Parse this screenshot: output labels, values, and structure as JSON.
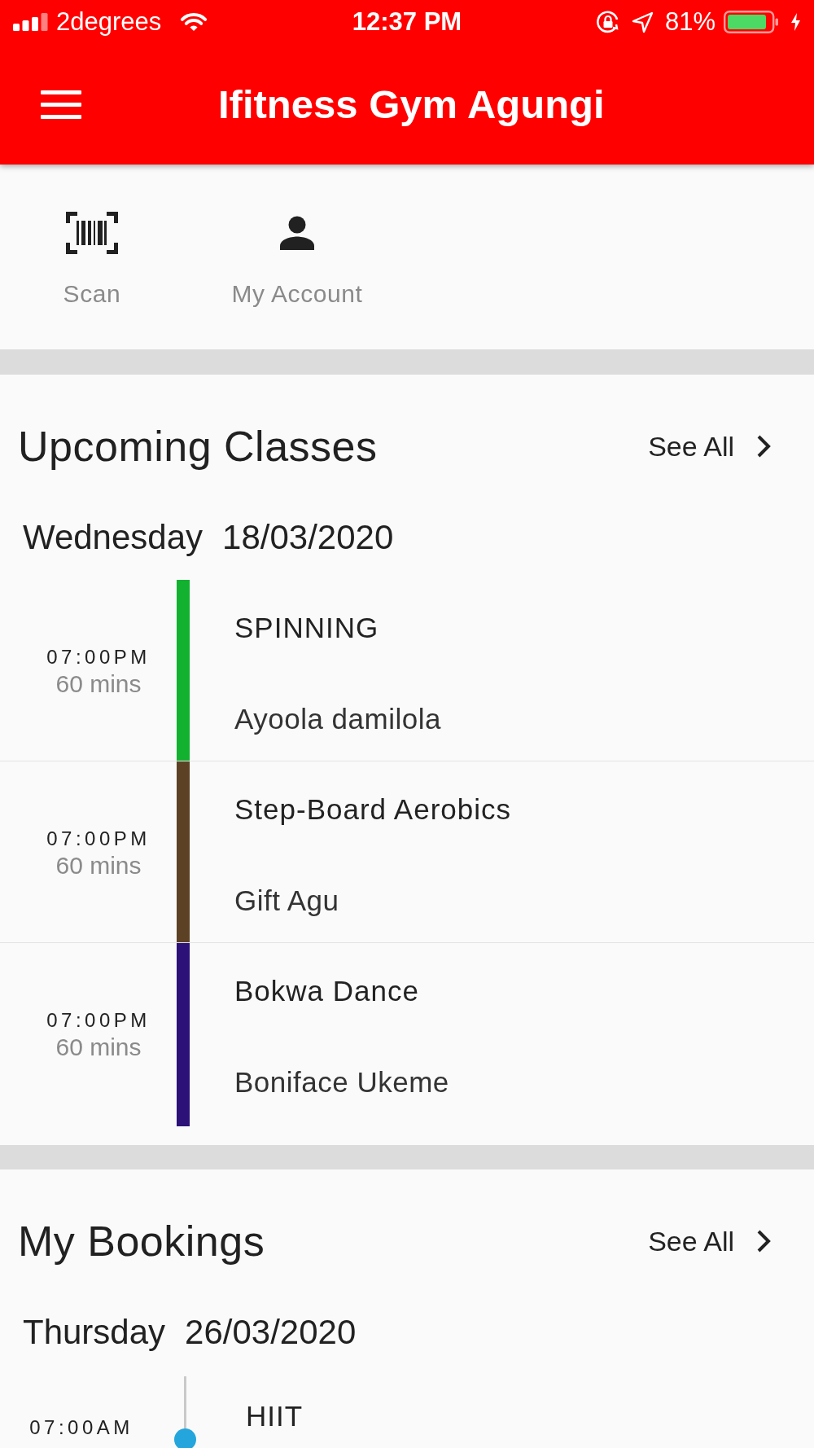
{
  "status_bar": {
    "carrier": "2degrees",
    "time": "12:37 PM",
    "battery": "81%"
  },
  "app_bar": {
    "title": "Ifitness Gym Agungi"
  },
  "quick_actions": [
    {
      "kind": "scan",
      "label": "Scan"
    },
    {
      "kind": "account",
      "label": "My Account"
    }
  ],
  "upcoming_classes": {
    "title": "Upcoming Classes",
    "see_all": "See All",
    "day": "Wednesday",
    "date": "18/03/2020",
    "classes": [
      {
        "time": "07:00PM",
        "duration": "60 mins",
        "name": "SPINNING",
        "instructor": "Ayoola damilola",
        "color": "#12b12f"
      },
      {
        "time": "07:00PM",
        "duration": "60 mins",
        "name": "Step-Board Aerobics",
        "instructor": "Gift Agu",
        "color": "#5c4125"
      },
      {
        "time": "07:00PM",
        "duration": "60 mins",
        "name": "Bokwa Dance",
        "instructor": "Boniface Ukeme",
        "color": "#2b1178"
      }
    ]
  },
  "my_bookings": {
    "title": "My Bookings",
    "see_all": "See All",
    "day": "Thursday",
    "date": "26/03/2020",
    "bookings": [
      {
        "time": "07:00AM",
        "name": "HIIT"
      }
    ]
  }
}
